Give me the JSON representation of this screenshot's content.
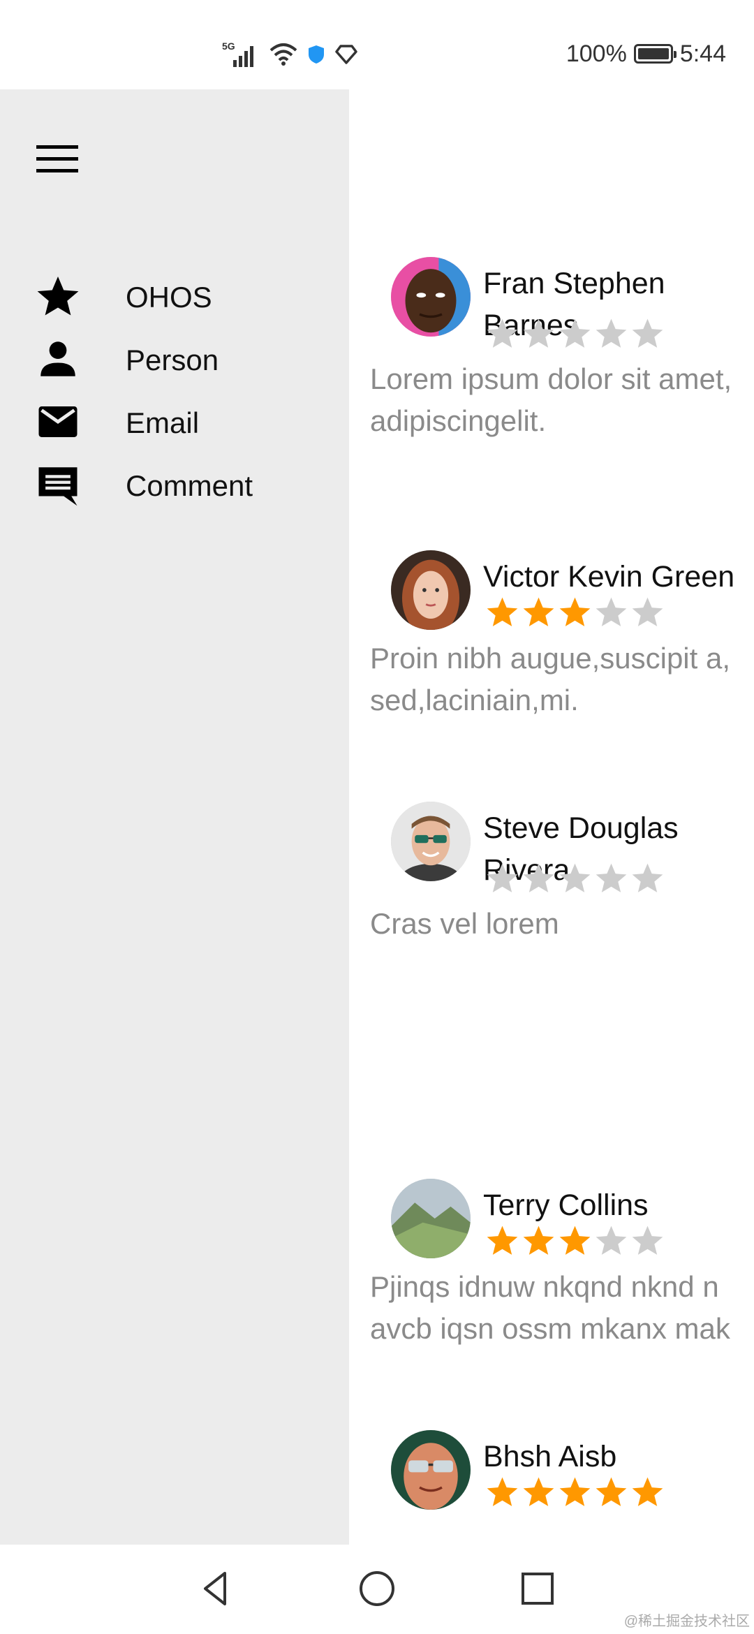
{
  "status_bar": {
    "network": "5G",
    "battery": "100%",
    "battery_level": 1.0,
    "time": "5:44"
  },
  "drawer": {
    "menu_icon": "hamburger-icon",
    "items": [
      {
        "label": "OHOS",
        "icon": "star-icon"
      },
      {
        "label": "Person",
        "icon": "person-icon"
      },
      {
        "label": "Email",
        "icon": "email-icon"
      },
      {
        "label": "Comment",
        "icon": "comment-icon"
      }
    ]
  },
  "reviews": [
    {
      "name": "Fran Stephen\nBarnes",
      "rating": 0,
      "text": "Lorem ipsum dolor sit amet,\nadipiscingelit."
    },
    {
      "name": "Victor Kevin Green",
      "rating": 3,
      "text": "Proin nibh augue,suscipit a,\nsed,laciniain,mi."
    },
    {
      "name": "Steve Douglas\nRivera",
      "rating": 0,
      "text": "Cras vel lorem"
    },
    {
      "name": "Terry Collins",
      "rating": 3,
      "text": "Pjinqs idnuw nkqnd nknd n\navcb iqsn ossm mkanx mak"
    },
    {
      "name": "Bhsh Aisb",
      "rating": 5,
      "text": ""
    }
  ],
  "colors": {
    "star_filled": "#FF9800",
    "star_empty": "#CCCCCC",
    "drawer_bg": "#ECECEC",
    "secondary_text": "#8A8A8A"
  },
  "watermark": "@稀土掘金技术社区"
}
